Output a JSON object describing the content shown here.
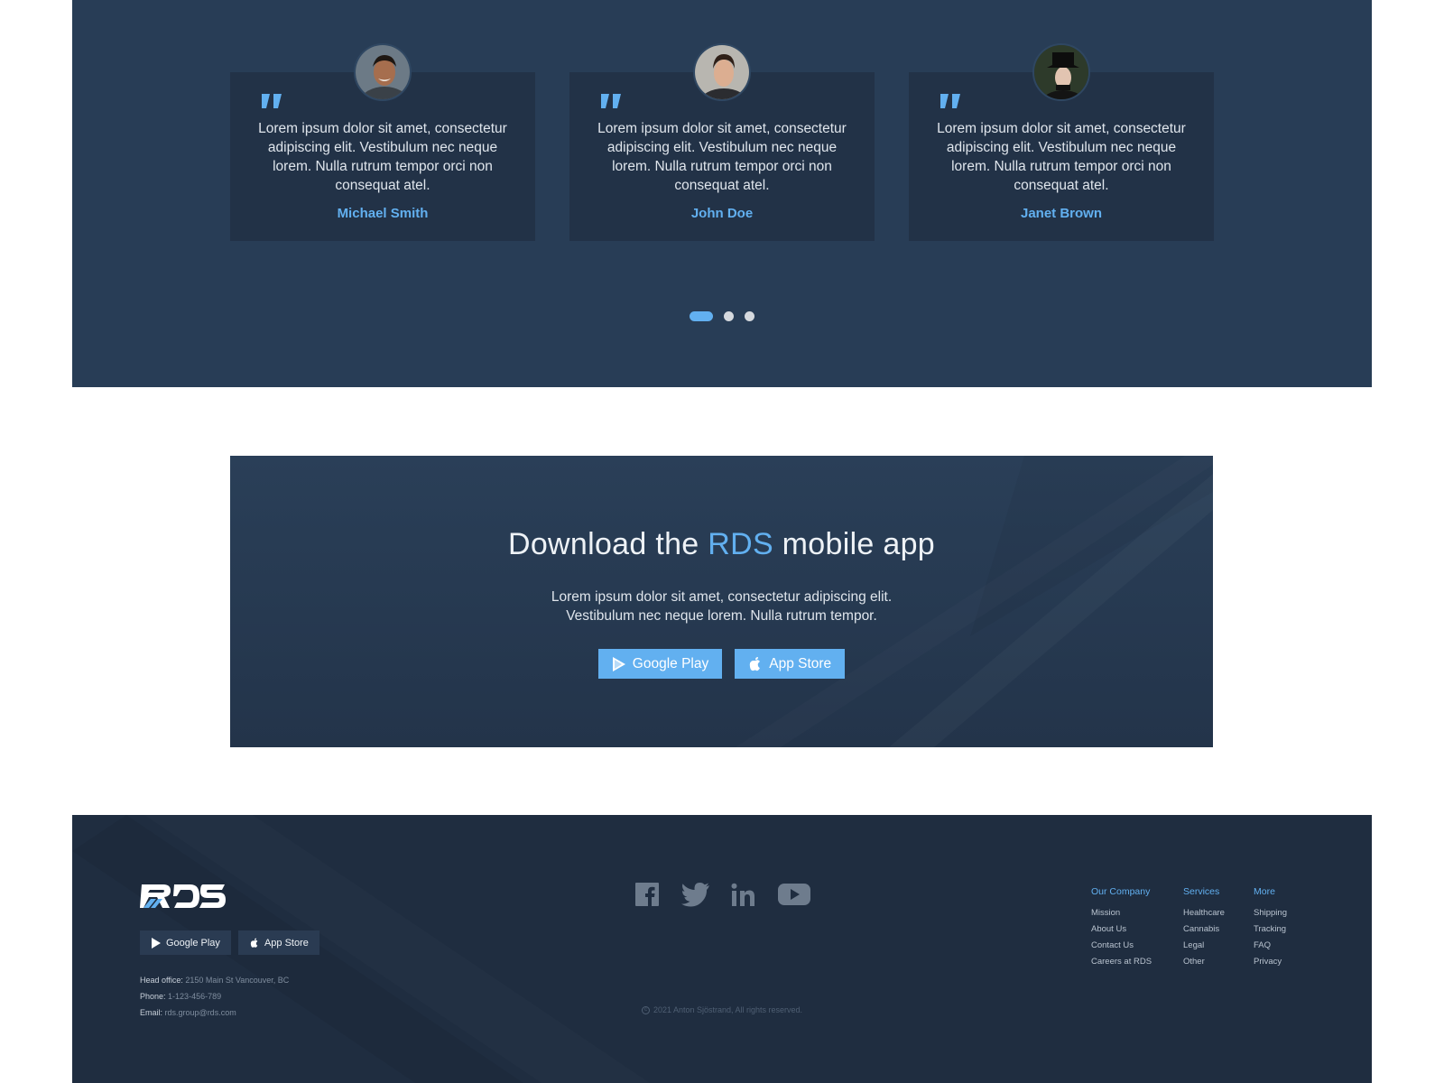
{
  "testimonials": {
    "items": [
      {
        "text": "Lorem ipsum dolor sit amet, consectetur adipiscing elit. Vestibulum nec neque lorem. Nulla rutrum tempor orci non consequat atel.",
        "name": "Michael Smith"
      },
      {
        "text": "Lorem ipsum dolor sit amet, consectetur adipiscing elit. Vestibulum nec neque lorem. Nulla rutrum tempor orci non consequat atel.",
        "name": "John Doe"
      },
      {
        "text": "Lorem ipsum dolor sit amet, consectetur adipiscing elit. Vestibulum nec neque lorem. Nulla rutrum tempor orci non consequat atel.",
        "name": "Janet Brown"
      }
    ],
    "active_page": 1,
    "page_count": 3
  },
  "banner": {
    "title_before": "Download the ",
    "title_accent": "RDS",
    "title_after": " mobile app",
    "desc_line1": "Lorem ipsum dolor sit amet,  consectetur adipiscing elit.",
    "desc_line2": "Vestibulum nec neque lorem. Nulla rutrum tempor.",
    "google_play_label": "Google Play",
    "app_store_label": "App Store"
  },
  "footer": {
    "logo_text": "RDS",
    "google_play_label": "Google Play",
    "app_store_label": "App Store",
    "head_office_label": "Head office:",
    "head_office_value": "2150 Main St Vancouver, BC",
    "phone_label": "Phone:",
    "phone_value": "1-123-456-789",
    "email_label": "Email:",
    "email_value": "rds.group@rds.com",
    "copyright": "2021 Anton Sjöstrand, All rights reserved.",
    "social_icons": [
      "facebook-icon",
      "twitter-icon",
      "linkedin-icon",
      "youtube-icon"
    ],
    "columns": [
      {
        "heading": "Our Company",
        "links": [
          "Mission",
          "About Us",
          "Contact Us",
          "Careers at RDS"
        ]
      },
      {
        "heading": "Services",
        "links": [
          "Healthcare",
          "Cannabis",
          "Legal",
          "Other"
        ]
      },
      {
        "heading": "More",
        "links": [
          "Shipping",
          "Tracking",
          "FAQ",
          "Privacy"
        ]
      }
    ]
  },
  "colors": {
    "accent": "#62b0f0",
    "testimonials_bg": "#283d56",
    "card_bg": "#223247",
    "footer_bg": "#1f2d40"
  }
}
